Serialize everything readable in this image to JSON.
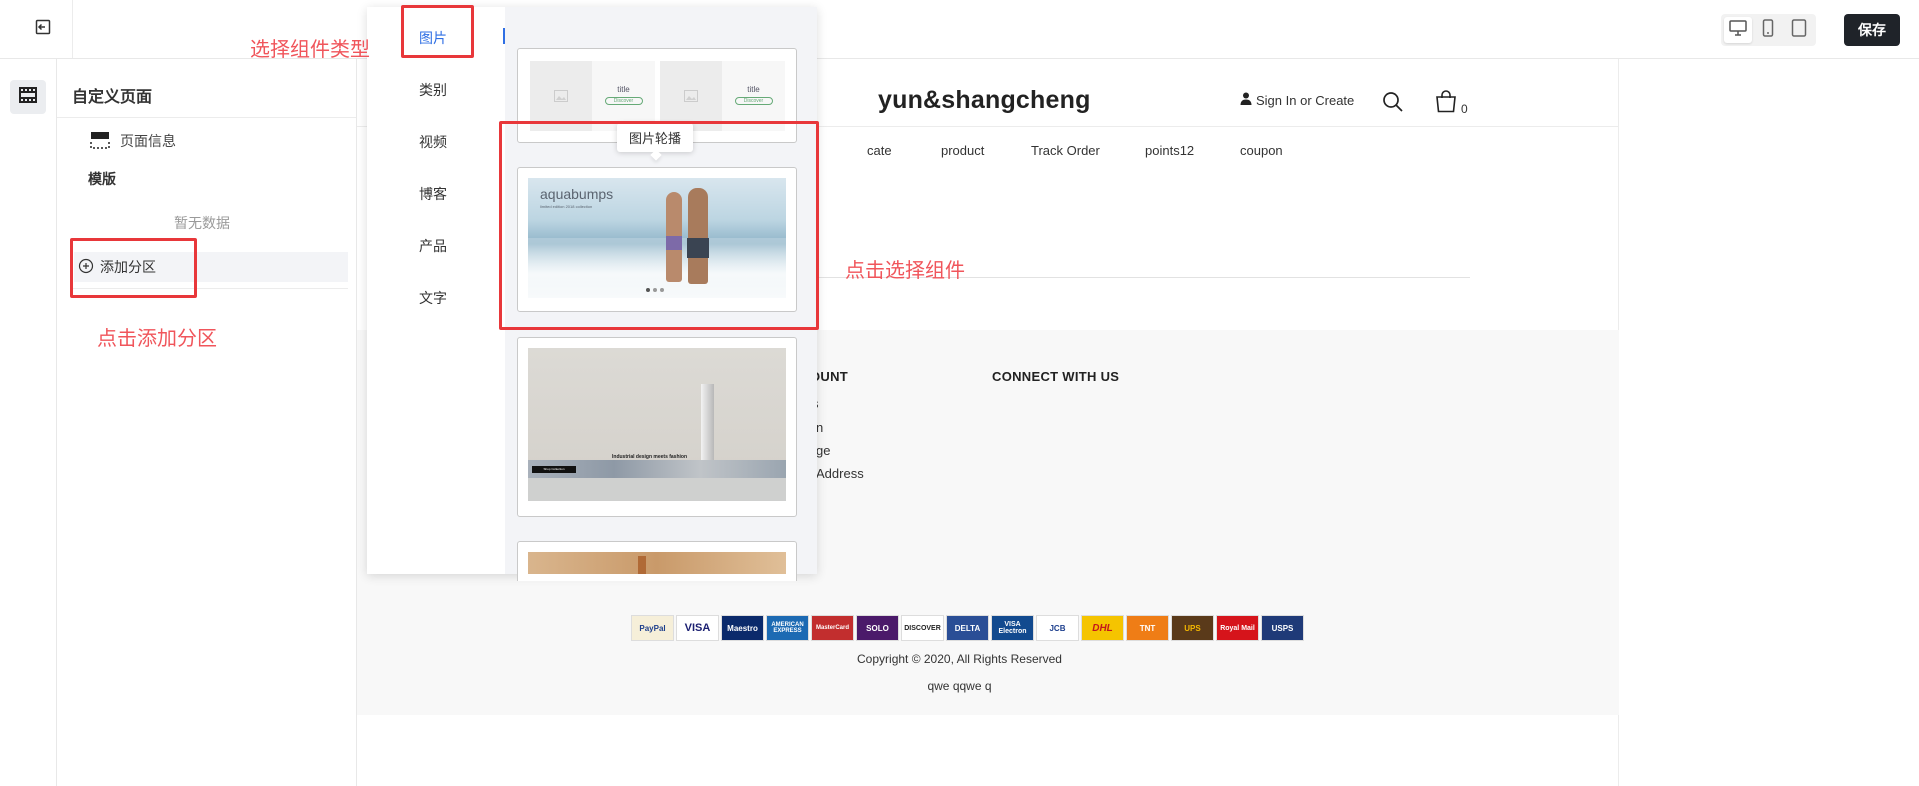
{
  "toolbar": {
    "save_label": "保存"
  },
  "panel": {
    "title": "自定义页面",
    "page_info_label": "页面信息",
    "template_label": "模版",
    "empty_text": "暂无数据",
    "add_section_label": "添加分区"
  },
  "store": {
    "title": "yun&shangcheng",
    "sign_in": "Sign In or Create",
    "cart_count": "0",
    "nav": [
      "cate",
      "product",
      "Track Order",
      "points12",
      "coupon"
    ],
    "footer": {
      "account_heading_visible": "OUNT",
      "connect_heading": "CONNECT WITH US",
      "account_links_visible": [
        "s",
        "n",
        "ge",
        "Address"
      ]
    },
    "payments": [
      "PayPal",
      "VISA",
      "Maestro",
      "AMERICAN EXPRESS",
      "MasterCard",
      "SOLO",
      "DISCOVER",
      "DELTA",
      "VISA Electron",
      "JCB",
      "DHL",
      "TNT",
      "UPS",
      "Royal Mail",
      "USPS"
    ],
    "copyright": "Copyright © 2020, All Rights Reserved",
    "footnote": "qwe qqwe q"
  },
  "popup": {
    "categories": [
      "图片",
      "类别",
      "视频",
      "博客",
      "产品",
      "文字"
    ],
    "active_category": "图片",
    "tooltip": "图片轮播",
    "card1": {
      "title_text": "title",
      "button_text": "Discover"
    },
    "card2": {
      "brand": "aquabumps",
      "tagline": "limited edition 2018 collection"
    },
    "card3": {
      "caption": "Industrial design meets fashion",
      "badge": "Shop Collection"
    }
  },
  "annotations": {
    "select_type": "选择组件类型",
    "click_select": "点击选择组件",
    "click_add": "点击添加分区"
  },
  "colors": {
    "accent": "#2f6fe4",
    "annotation": "#e8373a",
    "save_bg": "#1f2329"
  }
}
